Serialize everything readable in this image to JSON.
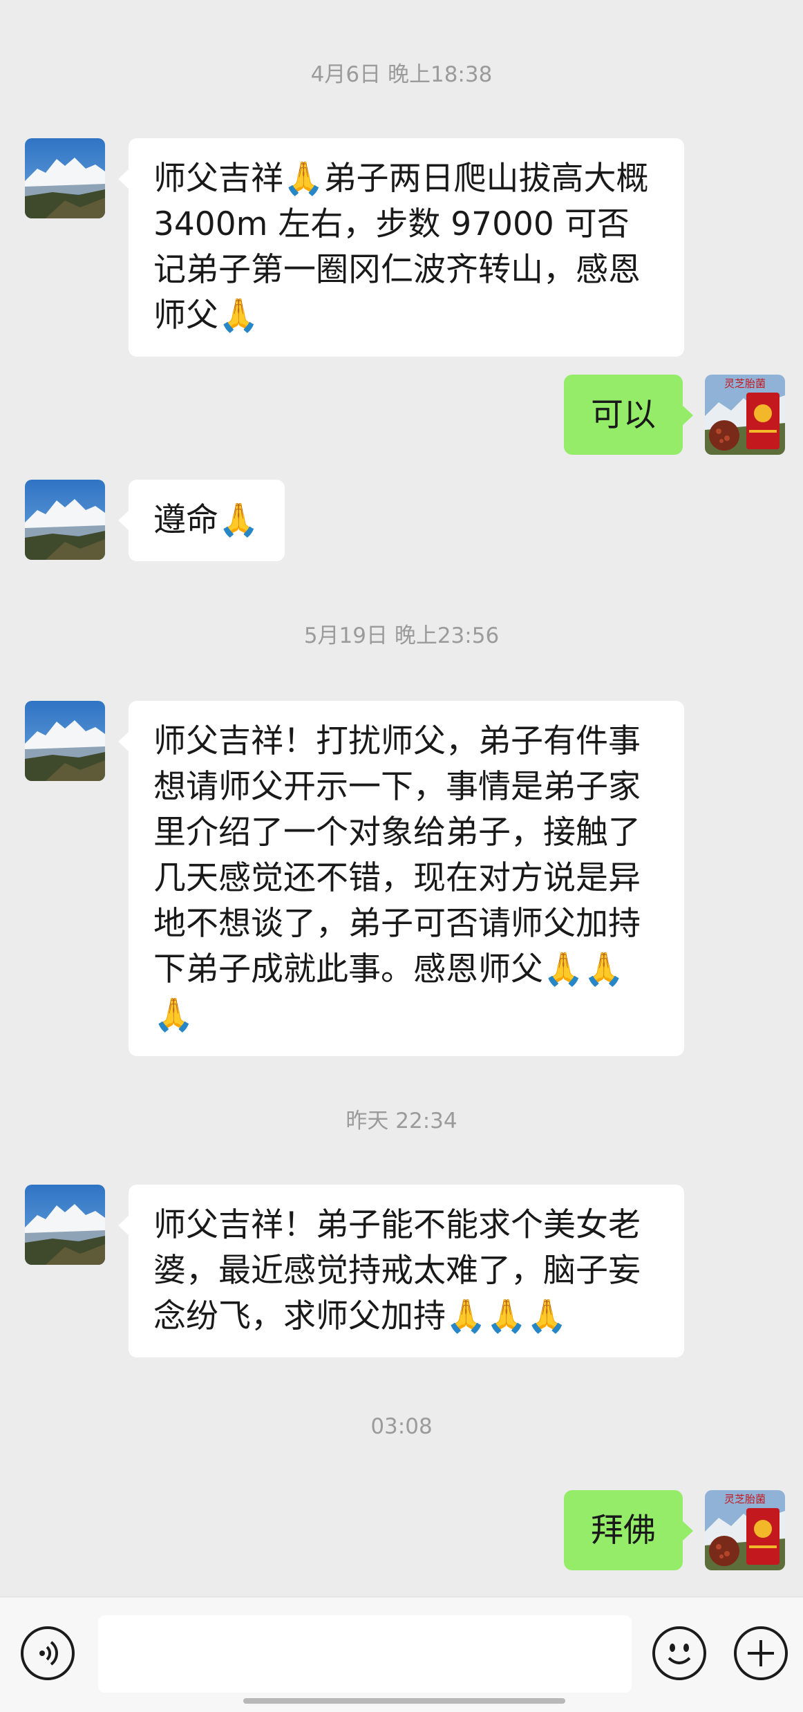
{
  "messages": [
    {
      "type": "timestamp",
      "text": "4月6日 晚上18:38"
    },
    {
      "type": "left",
      "text": "师父吉祥🙏弟子两日爬山拔高大概3400m 左右，步数 97000 可否记弟子第一圈冈仁波齐转山，感恩师父🙏"
    },
    {
      "type": "right",
      "text": "可以"
    },
    {
      "type": "left",
      "text": "遵命🙏"
    },
    {
      "type": "timestamp",
      "text": "5月19日 晚上23:56"
    },
    {
      "type": "left",
      "text": "师父吉祥！打扰师父，弟子有件事想请师父开示一下，事情是弟子家里介绍了一个对象给弟子，接触了几天感觉还不错，现在对方说是异地不想谈了，弟子可否请师父加持下弟子成就此事。感恩师父🙏🙏🙏"
    },
    {
      "type": "timestamp",
      "text": "昨天 22:34"
    },
    {
      "type": "left",
      "text": "师父吉祥！弟子能不能求个美女老婆，最近感觉持戒太难了，脑子妄念纷飞，求师父加持🙏🙏🙏"
    },
    {
      "type": "timestamp",
      "text": "03:08"
    },
    {
      "type": "right",
      "text": "拜佛"
    }
  ],
  "right_avatar_text": "灵芝胎菌",
  "icons": {
    "voice": "voice-icon",
    "emoji": "emoji-icon",
    "add": "add-icon"
  },
  "colors": {
    "background": "#ececec",
    "left_bubble": "#ffffff",
    "right_bubble": "#95ec69"
  }
}
